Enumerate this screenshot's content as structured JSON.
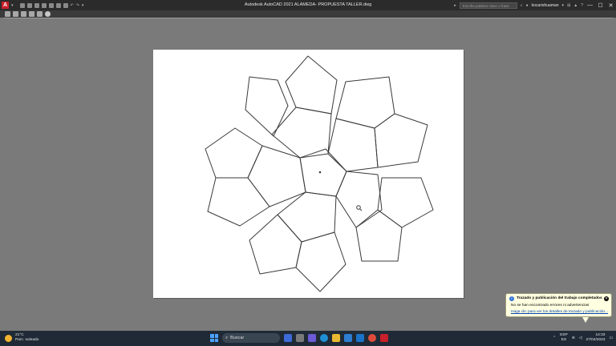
{
  "titlebar": {
    "logo": "A",
    "window_title": "Autodesk AutoCAD 2021    ALAMEDA- PROPUESTA TALLER.dwg",
    "search_placeholder": "Escriba palabra clave o frase",
    "user": "kocarishuaman",
    "window_controls": [
      "—",
      "☐",
      "✕"
    ]
  },
  "notification": {
    "title": "Trazado y publicación del trabajo completados",
    "message": "No se han encontrado errores ni advertencias",
    "link": "Haga clic para ver los detalles de trazado y publicación...",
    "close": "✕",
    "info": "i"
  },
  "taskbar": {
    "temperature": "21°C",
    "weather": "Parc. soleado",
    "search_label": "Buscar",
    "lang_top": "ESP",
    "lang_bottom": "ES",
    "time": "14:33",
    "date": "27/04/2023"
  },
  "colors": {
    "titlebar": "#2b2b2b",
    "viewport": "#7a7a7a",
    "paper": "#ffffff",
    "autocad_red": "#c8202a",
    "notification_bg": "#ffffe1",
    "taskbar": "#1f2a36"
  },
  "icons": [
    "autocad-logo-icon",
    "search-icon",
    "user-icon",
    "cart-icon",
    "help-icon",
    "pan-icon",
    "zoom-icon",
    "plot-icon",
    "info-icon",
    "close-icon",
    "weather-sun-icon",
    "windows-start-icon"
  ]
}
